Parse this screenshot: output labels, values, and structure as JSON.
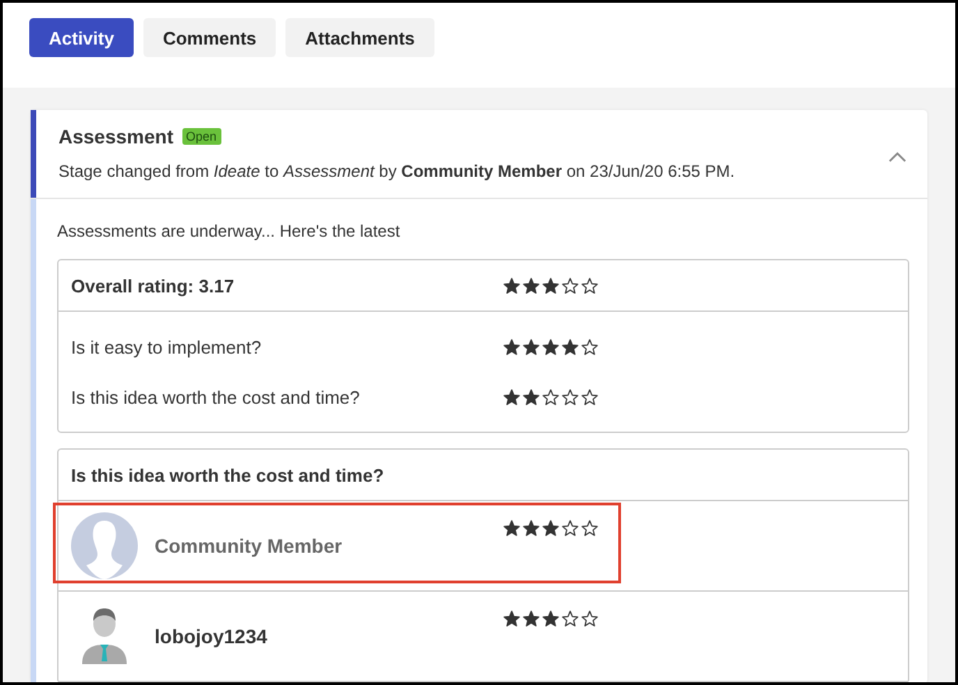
{
  "tabs": [
    {
      "label": "Activity",
      "selected": true
    },
    {
      "label": "Comments",
      "selected": false
    },
    {
      "label": "Attachments",
      "selected": false
    }
  ],
  "card": {
    "title": "Assessment",
    "badge": "Open",
    "expanded": true,
    "description": "Stage changed from *Ideate* to *Assessment* by **Community Member** on 23/Jun/20 6:55 PM.",
    "intro": "Assessments are underway... Here's the latest",
    "ratings": {
      "overall": {
        "label": "Overall rating: 3.17",
        "stars": 3
      },
      "questions": [
        {
          "text": "Is it easy to implement?",
          "stars": 4
        },
        {
          "text": "Is this idea worth the cost and time?",
          "stars": 2
        }
      ]
    },
    "responses": {
      "question": "Is this idea worth the cost and time?",
      "reviewers": [
        {
          "name": "Community Member",
          "kind": "placeholder",
          "stars": 3,
          "highlighted": true
        },
        {
          "name": "lobojoy1234",
          "kind": "person",
          "stars": 3,
          "highlighted": false
        }
      ]
    }
  }
}
